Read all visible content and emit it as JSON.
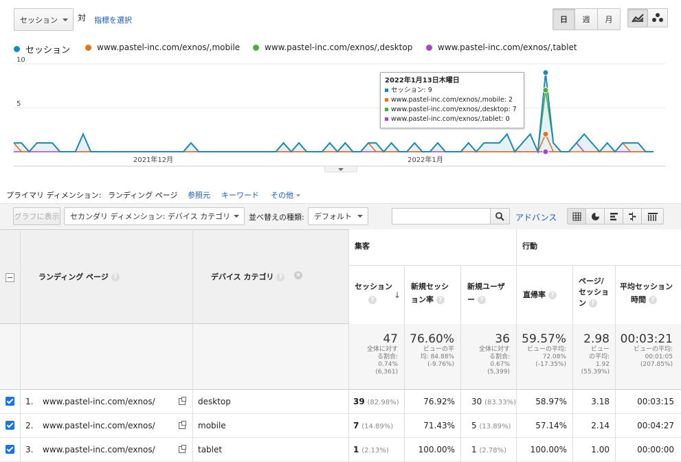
{
  "toolbar": {
    "metric_select": "セッション",
    "vs_label": "対",
    "select_metric_link": "指標を選択",
    "day": "日",
    "week": "週",
    "month": "月"
  },
  "legend": [
    {
      "label": "セッション",
      "color": "#1e88b6"
    },
    {
      "label": "www.pastel-inc.com/exnos/,mobile",
      "color": "#e8711c"
    },
    {
      "label": "www.pastel-inc.com/exnos/,desktop",
      "color": "#4cae3c"
    },
    {
      "label": "www.pastel-inc.com/exnos/,tablet",
      "color": "#a847c4"
    }
  ],
  "chart_data": {
    "type": "line",
    "ylim": [
      0,
      10
    ],
    "y_ticks": [
      "10",
      "5"
    ],
    "x_labels": [
      "2021年12月",
      "2022年1月"
    ],
    "series": [
      {
        "name": "セッション",
        "values": [
          1,
          1,
          0,
          1,
          1,
          1,
          0,
          0,
          0,
          2,
          0,
          0,
          0,
          0,
          0,
          0,
          0,
          0,
          0,
          0,
          0,
          0,
          0,
          1,
          0,
          0,
          0,
          0,
          0,
          0,
          0,
          0,
          0,
          0,
          0,
          1,
          0,
          1,
          0,
          0,
          0,
          1,
          0,
          1,
          0,
          0,
          1,
          1,
          0,
          1,
          0,
          0,
          1,
          0,
          0,
          1,
          0,
          0,
          0,
          1,
          0,
          1,
          1,
          1,
          2,
          0,
          1,
          2,
          0,
          9,
          1,
          0,
          0,
          1,
          2,
          1,
          0,
          1,
          0,
          1,
          1,
          1,
          0,
          0
        ]
      },
      {
        "name": "www.pastel-inc.com/exnos/,mobile",
        "values": [
          1,
          0,
          0,
          1,
          1,
          1,
          0,
          0,
          0,
          0,
          0,
          0,
          0,
          0,
          0,
          0,
          0,
          0,
          0,
          0,
          0,
          0,
          0,
          0,
          0,
          0,
          0,
          0,
          0,
          0,
          0,
          0,
          0,
          0,
          0,
          0,
          0,
          0,
          0,
          0,
          0,
          0,
          0,
          0,
          0,
          0,
          1,
          0,
          0,
          0,
          0,
          0,
          0,
          0,
          0,
          1,
          0,
          0,
          0,
          0,
          0,
          0,
          0,
          0,
          0,
          0,
          0,
          0,
          0,
          2,
          0,
          0,
          0,
          0,
          0,
          0,
          0,
          0,
          0,
          1,
          0,
          0,
          0,
          0
        ]
      },
      {
        "name": "www.pastel-inc.com/exnos/,desktop",
        "values": [
          1,
          1,
          0,
          1,
          1,
          1,
          0,
          0,
          0,
          2,
          0,
          0,
          0,
          0,
          0,
          0,
          0,
          0,
          0,
          0,
          0,
          0,
          0,
          1,
          0,
          0,
          0,
          0,
          0,
          0,
          0,
          0,
          0,
          0,
          0,
          1,
          0,
          1,
          0,
          0,
          0,
          1,
          0,
          1,
          0,
          0,
          1,
          1,
          0,
          1,
          0,
          0,
          1,
          0,
          0,
          1,
          0,
          0,
          0,
          1,
          0,
          1,
          1,
          1,
          2,
          0,
          1,
          2,
          0,
          7,
          1,
          0,
          0,
          1,
          2,
          1,
          0,
          1,
          0,
          1,
          1,
          1,
          0,
          0
        ]
      },
      {
        "name": "www.pastel-inc.com/exnos/,tablet",
        "values": [
          0,
          0,
          0,
          0,
          0,
          0,
          0,
          0,
          0,
          0,
          0,
          0,
          0,
          0,
          0,
          0,
          0,
          0,
          0,
          0,
          0,
          0,
          0,
          0,
          0,
          0,
          0,
          0,
          0,
          0,
          0,
          0,
          0,
          0,
          0,
          0,
          0,
          0,
          0,
          0,
          0,
          0,
          0,
          0,
          0,
          0,
          0,
          0,
          0,
          0,
          0,
          0,
          0,
          0,
          0,
          0,
          0,
          0,
          0,
          0,
          0,
          0,
          0,
          0,
          0,
          0,
          0,
          0,
          0,
          0,
          0,
          0,
          0,
          1,
          0,
          0,
          0,
          0,
          0,
          0,
          0,
          0,
          0,
          0
        ]
      }
    ]
  },
  "tooltip": {
    "title": "2022年1月13日木曜日",
    "lines": [
      {
        "text": "セッション: 9",
        "color": "#1e88b6"
      },
      {
        "text": "www.pastel-inc.com/exnos/,mobile: 2",
        "color": "#e8711c"
      },
      {
        "text": "www.pastel-inc.com/exnos/,desktop: 7",
        "color": "#4cae3c"
      },
      {
        "text": "www.pastel-inc.com/exnos/,tablet: 0",
        "color": "#a847c4"
      }
    ]
  },
  "dimension_bar": {
    "primary_label": "プライマリ ディメンション:",
    "active": "ランディング ページ",
    "ref": "参照元",
    "keyword": "キーワード",
    "other": "その他"
  },
  "controls": {
    "plot_rows": "グラフに表示",
    "secondary": "セカンダリ ディメンション: デバイス カテゴリ",
    "sort_label": "並べ替えの種類:",
    "sort_value": "デフォルト",
    "advanced": "アドバンス",
    "search_value": ""
  },
  "table": {
    "group_acq": "集客",
    "group_beh": "行動",
    "col_landing": "ランディング ページ",
    "col_device": "デバイス カテゴリ",
    "col_sessions": "セッション",
    "col_new_rate_1": "新規セッシ",
    "col_new_rate_2": "ョン率",
    "col_new_users_1": "新規ユーザ",
    "col_new_users_2": "ー",
    "col_bounce": "直帰率",
    "col_pps_1": "ページ/",
    "col_pps_2": "セッショ",
    "col_pps_3": "ン",
    "col_dur_1": "平均セッション",
    "col_dur_2": "時間",
    "totals": {
      "sessions": "47",
      "sessions_s1": "全体に対す",
      "sessions_s2": "る割合:",
      "sessions_s3": "0.74%",
      "sessions_s4": "(6,361)",
      "newrate": "76.60%",
      "newrate_s1": "ビューの平",
      "newrate_s2": "均: 84.88%",
      "newrate_s3": "(-9.76%)",
      "newusers": "36",
      "newusers_s1": "全体に対す",
      "newusers_s2": "る割合:",
      "newusers_s3": "0.67%",
      "newusers_s4": "(5,399)",
      "bounce": "59.57%",
      "bounce_s1": "ビューの平均:",
      "bounce_s2": "72.08%",
      "bounce_s3": "(-17.35%)",
      "pps": "2.98",
      "pps_s1": "ビュー",
      "pps_s2": "の平均:",
      "pps_s3": "1.92",
      "pps_s4": "(55.39%)",
      "dur": "00:03:21",
      "dur_s1": "ビューの平均:",
      "dur_s2": "00:01:05",
      "dur_s3": "(207.85%)"
    },
    "rows": [
      {
        "num": "1.",
        "page": "www.pastel-inc.com/exnos/",
        "device": "desktop",
        "sessions": "39",
        "sessions_pct": "(82.98%)",
        "newrate": "76.92%",
        "newusers": "30",
        "newusers_pct": "(83.33%)",
        "bounce": "58.97%",
        "pps": "3.18",
        "dur": "00:03:15"
      },
      {
        "num": "2.",
        "page": "www.pastel-inc.com/exnos/",
        "device": "mobile",
        "sessions": "7",
        "sessions_pct": "(14.89%)",
        "newrate": "71.43%",
        "newusers": "5",
        "newusers_pct": "(13.89%)",
        "bounce": "57.14%",
        "pps": "2.14",
        "dur": "00:04:27"
      },
      {
        "num": "3.",
        "page": "www.pastel-inc.com/exnos/",
        "device": "tablet",
        "sessions": "1",
        "sessions_pct": "(2.13%)",
        "newrate": "100.00%",
        "newusers": "1",
        "newusers_pct": "(2.78%)",
        "bounce": "100.00%",
        "pps": "1.00",
        "dur": "00:00:00"
      }
    ]
  }
}
